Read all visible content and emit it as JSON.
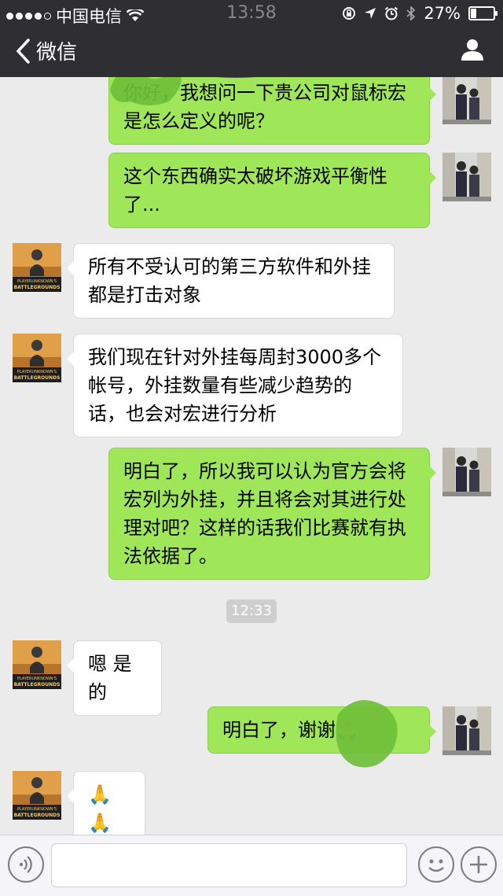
{
  "status_bar": {
    "carrier": "中国电信",
    "time": "13:58",
    "battery": "27%",
    "battery_level": 0.27
  },
  "nav": {
    "back_label": "微信",
    "back_icon": "chevron-left-icon",
    "profile_icon": "user-profile-icon"
  },
  "messages": [
    {
      "side": "out",
      "text": "你好，我想问一下贵公司对鼠标宏是怎么定义的呢？"
    },
    {
      "side": "out",
      "text": "这个东西确实太破坏游戏平衡性了..."
    },
    {
      "side": "in",
      "text": "所有不受认可的第三方软件和外挂都是打击对象"
    },
    {
      "side": "in",
      "text": "我们现在针对外挂每周封3000多个帐号，外挂数量有些减少趋势的话，也会对宏进行分析"
    },
    {
      "side": "out",
      "text": "明白了，所以我可以认为官方会将宏列为外挂，并且将会对其进行处理对吧？这样的话我们比赛就有执法依据了。"
    },
    {
      "side": "in",
      "text": "嗯 是的"
    },
    {
      "side": "out",
      "text": "明白了，谢谢🙏"
    },
    {
      "side": "in",
      "text": "🙏🙏"
    }
  ],
  "timestamp": "12:33",
  "avatar_in": {
    "text_top": "PLAYERUNKNOWN'S",
    "text_bottom": "BATTLEGROUNDS"
  },
  "input_bar": {
    "placeholder": "",
    "voice_icon": "voice-icon",
    "emoji_icon": "emoji-icon",
    "plus_icon": "plus-icon"
  },
  "colors": {
    "nav_bg": "#2e2e33",
    "chat_bg": "#ebebeb",
    "bubble_out": "#9fe759",
    "bubble_in": "#ffffff"
  }
}
